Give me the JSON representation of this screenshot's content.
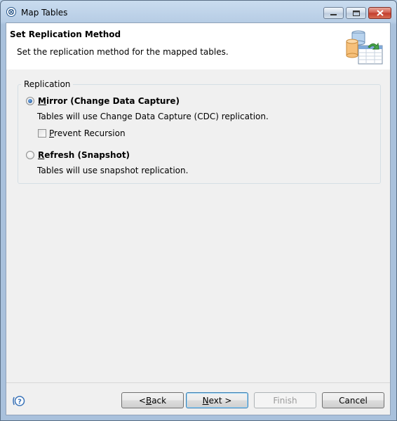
{
  "window": {
    "title": "Map Tables"
  },
  "header": {
    "title": "Set Replication Method",
    "description": "Set the replication method for the mapped tables."
  },
  "replication": {
    "group_label": "Replication",
    "options": [
      {
        "mnemonic": "M",
        "label_rest": "irror (Change Data Capture)",
        "description": "Tables will use Change Data Capture (CDC) replication.",
        "selected": true
      },
      {
        "mnemonic": "R",
        "label_rest": "efresh (Snapshot)",
        "description": "Tables will use snapshot replication.",
        "selected": false
      }
    ],
    "prevent_recursion": {
      "mnemonic": "P",
      "label_rest": "revent Recursion",
      "checked": false
    }
  },
  "footer": {
    "back": {
      "pre": "< ",
      "mnemonic": "B",
      "rest": "ack"
    },
    "next": {
      "mnemonic": "N",
      "rest": "ext >"
    },
    "finish": {
      "label": "Finish",
      "enabled": false
    },
    "cancel": {
      "label": "Cancel"
    }
  },
  "icons": {
    "app": "app-logo-icon",
    "header": "database-table-icon",
    "help": "help-icon"
  },
  "colors": {
    "accent": "#3c7fb1",
    "titlebar": "#bcd3ea"
  }
}
